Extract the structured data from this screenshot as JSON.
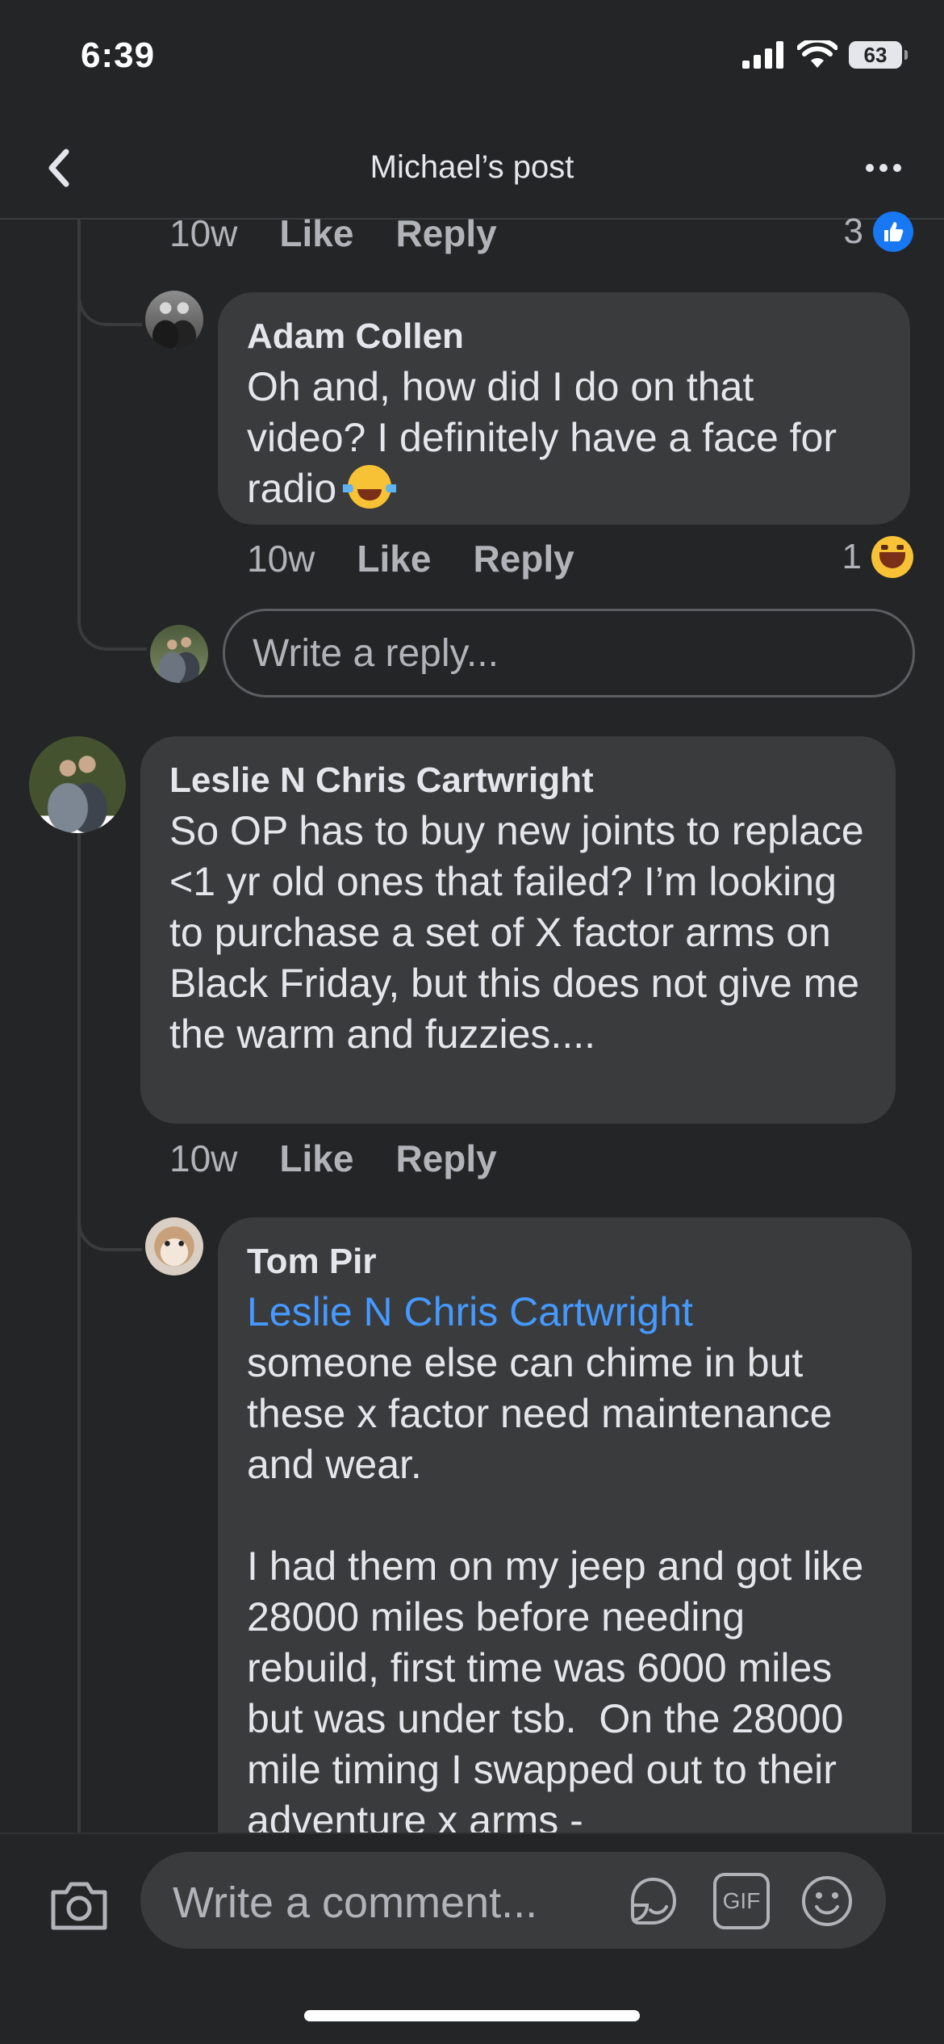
{
  "status": {
    "time": "6:39",
    "battery": "63"
  },
  "nav": {
    "title": "Michael’s post"
  },
  "prev_comment_actions": {
    "age": "10w",
    "like": "Like",
    "reply": "Reply",
    "reaction_count": "3"
  },
  "comments": [
    {
      "author": "Adam Collen",
      "text": "Oh and, how did I do on that video? I definitely have a face for radio",
      "age": "10w",
      "like": "Like",
      "reply": "Reply",
      "reaction_count": "1"
    },
    {
      "author": "Leslie N Chris Cartwright",
      "text": "So OP has to buy new joints to replace <1 yr old ones that failed? I’m looking to purchase a set of X factor arms on Black Friday, but this does not give me the warm and fuzzies....",
      "age": "10w",
      "like": "Like",
      "reply": "Reply"
    },
    {
      "author": "Tom Pir",
      "mention": "Leslie N Chris Cartwright",
      "text": "someone else can chime in but these x factor need maintenance and wear.\n\nI had them on my jeep and got like 28000 miles before needing rebuild, first time was 6000 miles but was under tsb.  On the 28000 mile timing I swapped out to their adventure x arms -"
    }
  ],
  "reply_input": {
    "placeholder": "Write a reply..."
  },
  "composer": {
    "placeholder": "Write a comment...",
    "gif_label": "GIF"
  },
  "icons": [
    "back-icon",
    "more-icon",
    "like-icon",
    "haha-icon",
    "camera-icon",
    "sticker-icon",
    "gif-icon",
    "emoji-icon"
  ],
  "colors": {
    "background": "#242526",
    "bubble": "#3a3b3c",
    "mention": "#4599ff",
    "like": "#1877f2"
  }
}
